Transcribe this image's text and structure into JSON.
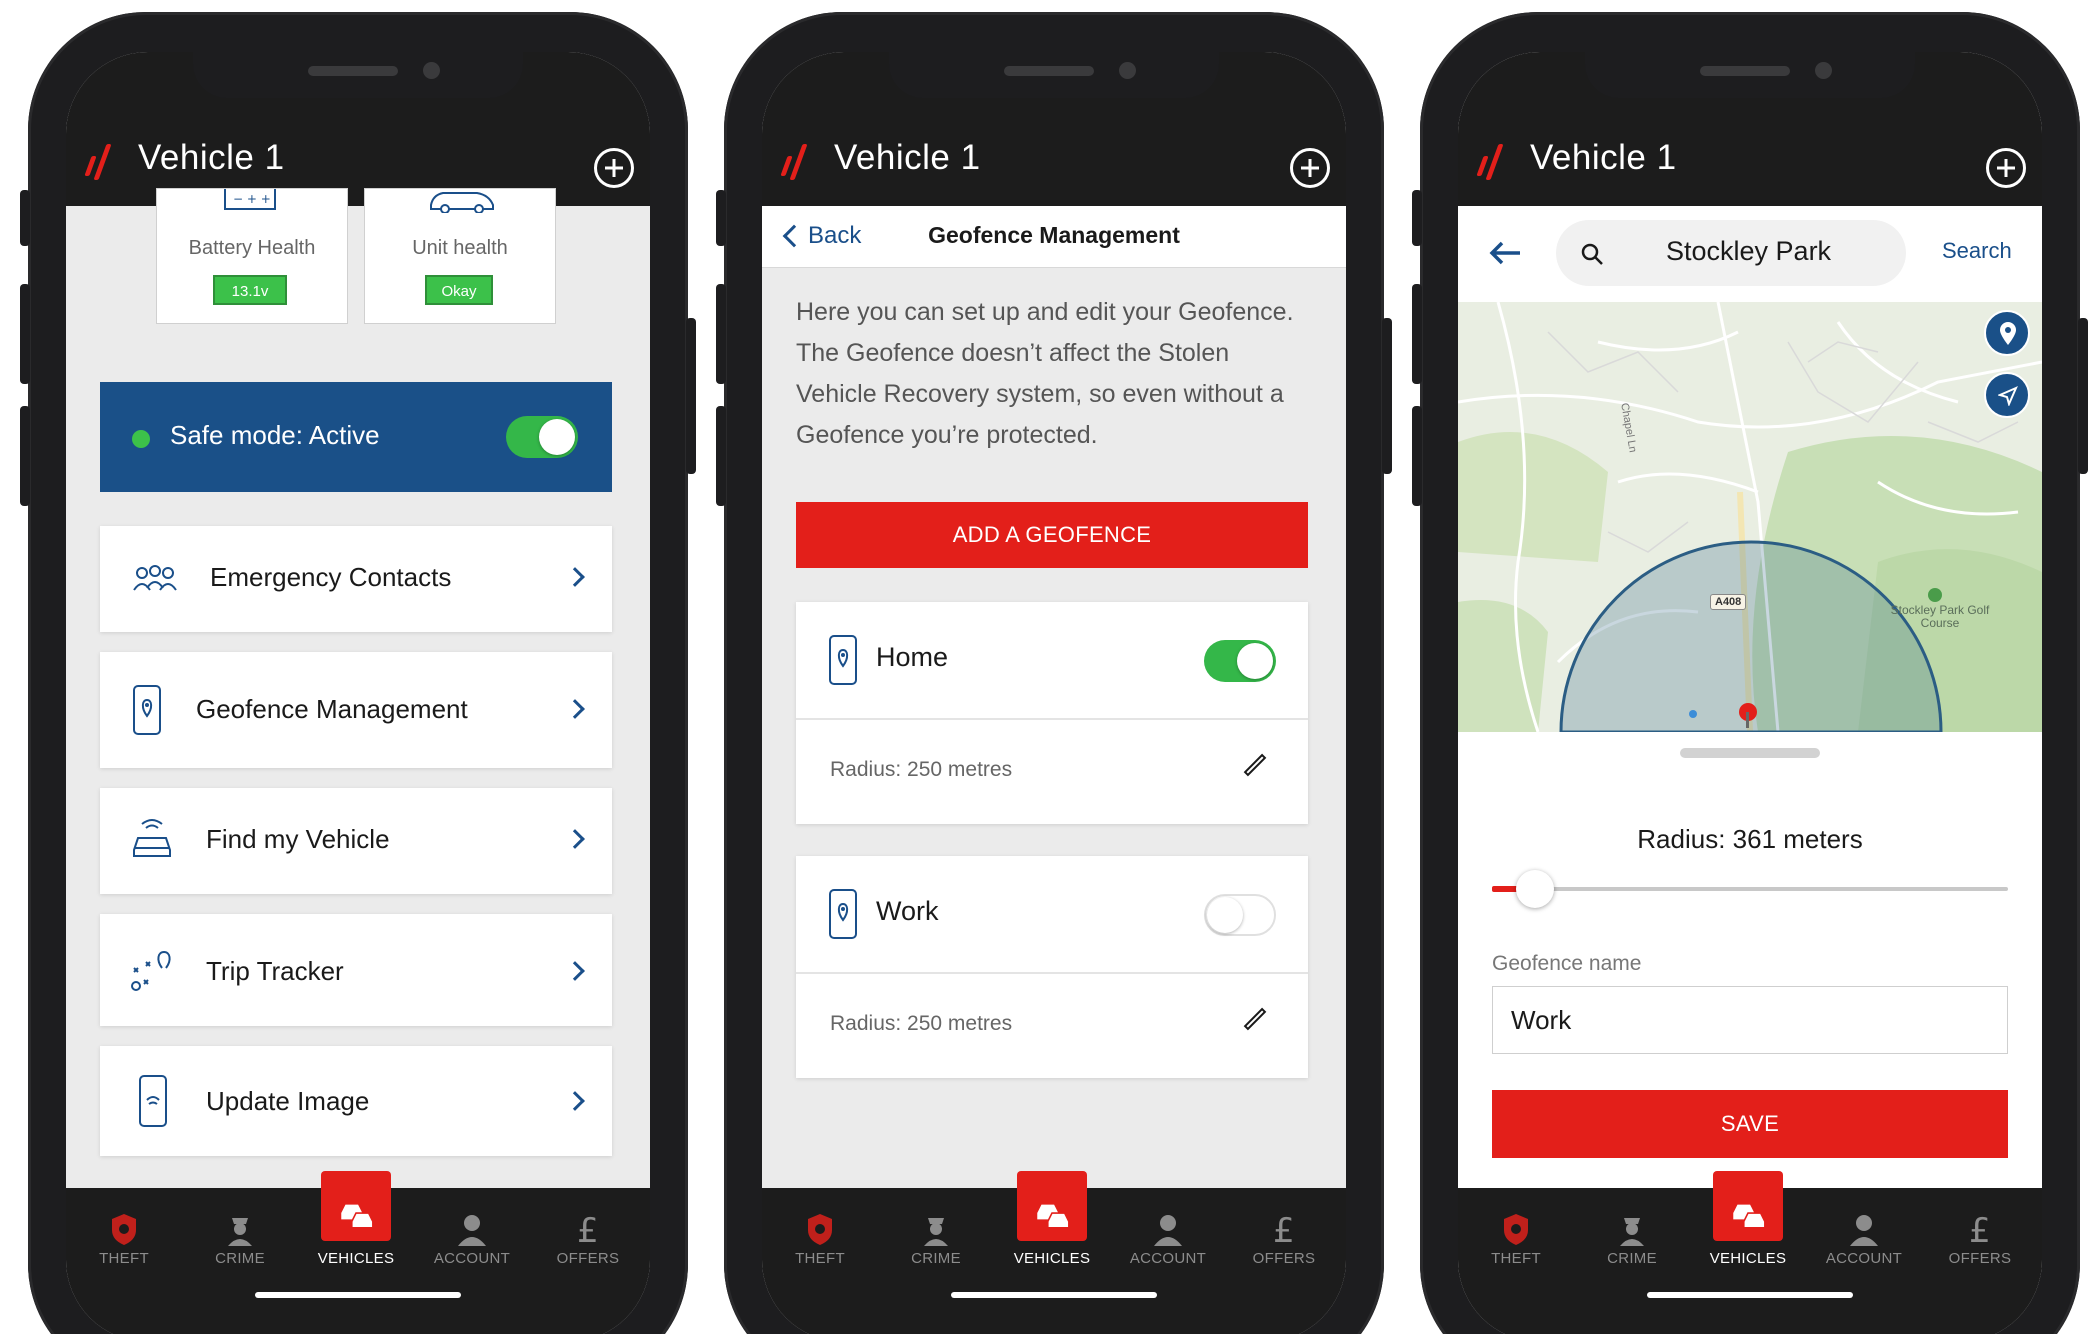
{
  "app": {
    "title": "Vehicle 1"
  },
  "colors": {
    "brand_red": "#e31f1a",
    "header_dark": "#1c1c1c",
    "safe_mode_blue": "#1a5088",
    "toggle_green": "#34b749",
    "badge_green": "#3cc14a",
    "link_blue": "#1a4f8a"
  },
  "nav": [
    {
      "label": "THEFT",
      "icon": "shield-icon"
    },
    {
      "label": "CRIME",
      "icon": "officer-icon"
    },
    {
      "label": "VEHICLES",
      "icon": "cars-icon"
    },
    {
      "label": "ACCOUNT",
      "icon": "person-icon"
    },
    {
      "label": "OFFERS",
      "icon": "pound-icon"
    }
  ],
  "screen1": {
    "tiles": [
      {
        "label": "Battery Health",
        "badge": "13.1v",
        "icon": "battery-icon"
      },
      {
        "label": "Unit health",
        "badge": "Okay",
        "icon": "car-outline-icon"
      }
    ],
    "safe_mode": {
      "label": "Safe mode: Active"
    },
    "menu": [
      {
        "label": "Emergency Contacts",
        "icon": "contacts-icon"
      },
      {
        "label": "Geofence Management",
        "icon": "geofence-phone-icon"
      },
      {
        "label": "Find my Vehicle",
        "icon": "car-signal-icon"
      },
      {
        "label": "Trip Tracker",
        "icon": "route-icon"
      },
      {
        "label": "Update Image",
        "icon": "phone-image-icon"
      }
    ]
  },
  "screen2": {
    "back_label": "Back",
    "title": "Geofence Management",
    "intro": "Here you can set up and edit your Geofence. The Geofence doesn’t affect the Stolen Vehicle Recovery system, so even without a Geofence you’re protected.",
    "add_button": "ADD A GEOFENCE",
    "geofences": [
      {
        "name": "Home",
        "radius": "Radius: 250 metres",
        "enabled": true
      },
      {
        "name": "Work",
        "radius": "Radius: 250 metres",
        "enabled": false
      }
    ]
  },
  "screen3": {
    "search_value": "Stockley Park",
    "search_button": "Search",
    "map_labels": {
      "road": "A408",
      "street": "Chapel Ln",
      "poi": "Stockley Park Golf Course"
    },
    "radius_label": "Radius: 361 meters",
    "radius_fraction": 0.05,
    "name_label": "Geofence name",
    "name_value": "Work",
    "save_button": "SAVE"
  }
}
